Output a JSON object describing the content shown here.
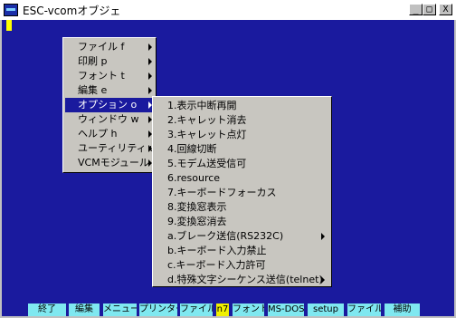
{
  "window": {
    "title": "ESC-vcomオブジェ",
    "minimize": "_",
    "maximize": "□",
    "close": "X"
  },
  "main_menu": {
    "items": [
      {
        "label": "ファイル f"
      },
      {
        "label": "印刷 p"
      },
      {
        "label": "フォント t"
      },
      {
        "label": "編集 e"
      },
      {
        "label": "オプション o",
        "selected": true
      },
      {
        "label": "ウィンドウ w"
      },
      {
        "label": "ヘルプ h"
      },
      {
        "label": "ユーティリティ u"
      },
      {
        "label": "VCMモジュール"
      }
    ]
  },
  "submenu": {
    "items": [
      {
        "label": "1.表示中断再開"
      },
      {
        "label": "2.キャレット消去"
      },
      {
        "label": "3.キャレット点灯"
      },
      {
        "label": "4.回線切断"
      },
      {
        "label": "5.モデム送受信可"
      },
      {
        "label": "6.resource"
      },
      {
        "label": "7.キーボードフォーカス"
      },
      {
        "label": "8.変換窓表示"
      },
      {
        "label": "9.変換窓消去"
      },
      {
        "label": "a.ブレーク送信(RS232C)",
        "has_submenu": true
      },
      {
        "label": "b.キーボード入力禁止"
      },
      {
        "label": "c.キーボード入力許可"
      },
      {
        "label": "d.特殊文字シーケンス送信(telnet)",
        "has_submenu": true
      }
    ]
  },
  "function_keys": [
    {
      "label": "終了"
    },
    {
      "label": "編集"
    },
    {
      "label": "メニュー"
    },
    {
      "label": "プリンター"
    },
    {
      "label": "ファイル受"
    },
    {
      "label": "n7",
      "highlight": true
    },
    {
      "label": "フォント"
    },
    {
      "label": "MS-DOS"
    },
    {
      "label": "setup"
    },
    {
      "label": "ファイル送"
    },
    {
      "label": "補助"
    }
  ],
  "colors": {
    "terminal_bg": "#1a1a9e",
    "fkey_bg": "#7fe8f0",
    "fkey_highlight": "#f0f000",
    "cursor": "#ffff00"
  }
}
